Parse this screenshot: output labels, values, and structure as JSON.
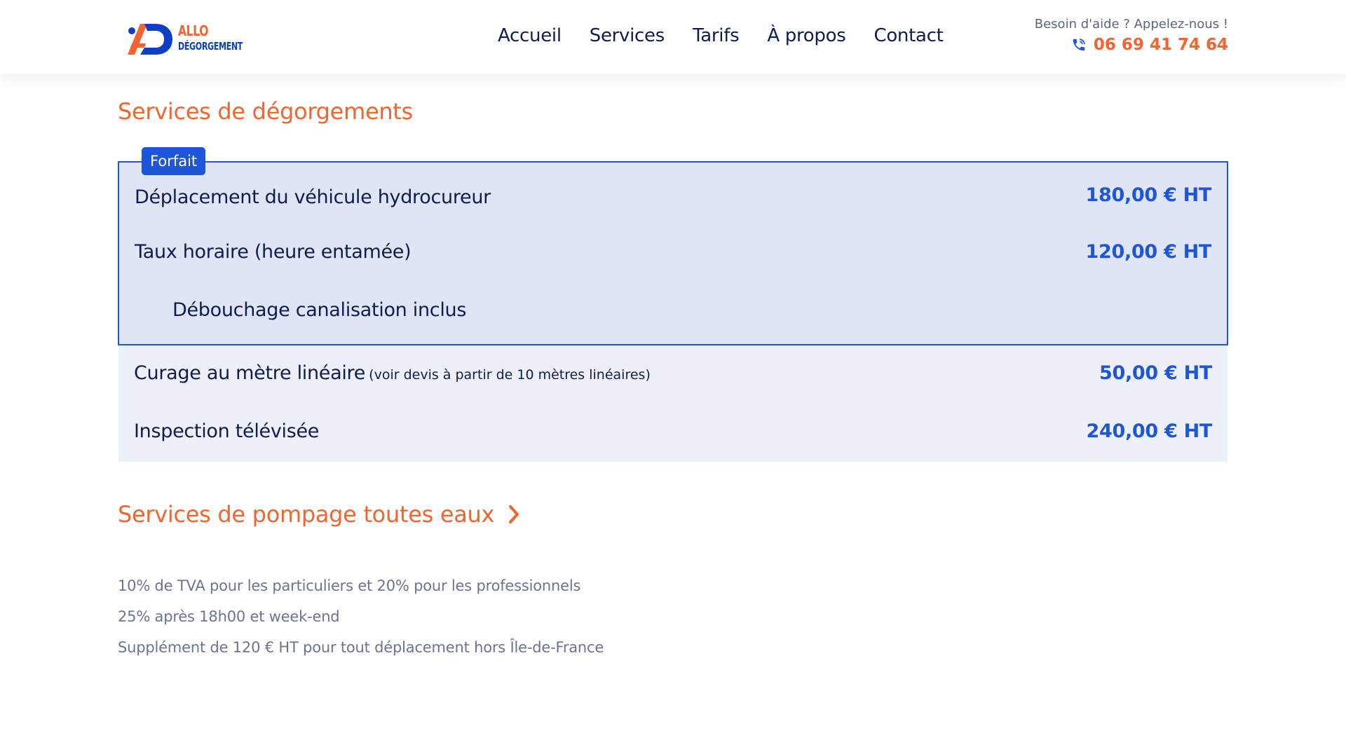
{
  "header": {
    "logo": {
      "line1": "ALLO",
      "line2": "DÉGORGEMENT"
    },
    "nav": [
      {
        "label": "Accueil"
      },
      {
        "label": "Services"
      },
      {
        "label": "Tarifs"
      },
      {
        "label": "À propos"
      },
      {
        "label": "Contact"
      }
    ],
    "help_text": "Besoin d'aide ? Appelez-nous !",
    "phone": "06 69 41 74 64",
    "phone_icon": "phone-icon"
  },
  "main": {
    "section1_title": "Services de dégorgements",
    "forfait_badge": "Forfait",
    "forfait_rows": [
      {
        "label": "Déplacement du véhicule hydrocureur",
        "price": "180,00 € HT"
      },
      {
        "label": "Taux horaire (heure entamée)",
        "price": "120,00 € HT"
      },
      {
        "label": "Débouchage canalisation inclus",
        "price": ""
      }
    ],
    "other_rows": [
      {
        "label": "Curage au mètre linéaire",
        "note": "(voir devis à partir de 10 mètres linéaires)",
        "price": "50,00 € HT"
      },
      {
        "label": "Inspection télévisée",
        "price": "240,00 € HT"
      }
    ],
    "section2_title": "Services de pompage toutes eaux",
    "section2_icon": "chevron-right-icon",
    "notes": [
      "10% de TVA pour les particuliers et 20% pour les professionnels",
      "25% après 18h00 et week-end",
      "Supplément de 120 € HT pour tout déplacement hors Île-de-France"
    ]
  },
  "colors": {
    "accent_orange": "#f26430",
    "accent_blue": "#1e56d8",
    "navy": "#0e1d4f",
    "forfait_bg": "#dfe5f5",
    "row_bg": "#eef0f8"
  }
}
